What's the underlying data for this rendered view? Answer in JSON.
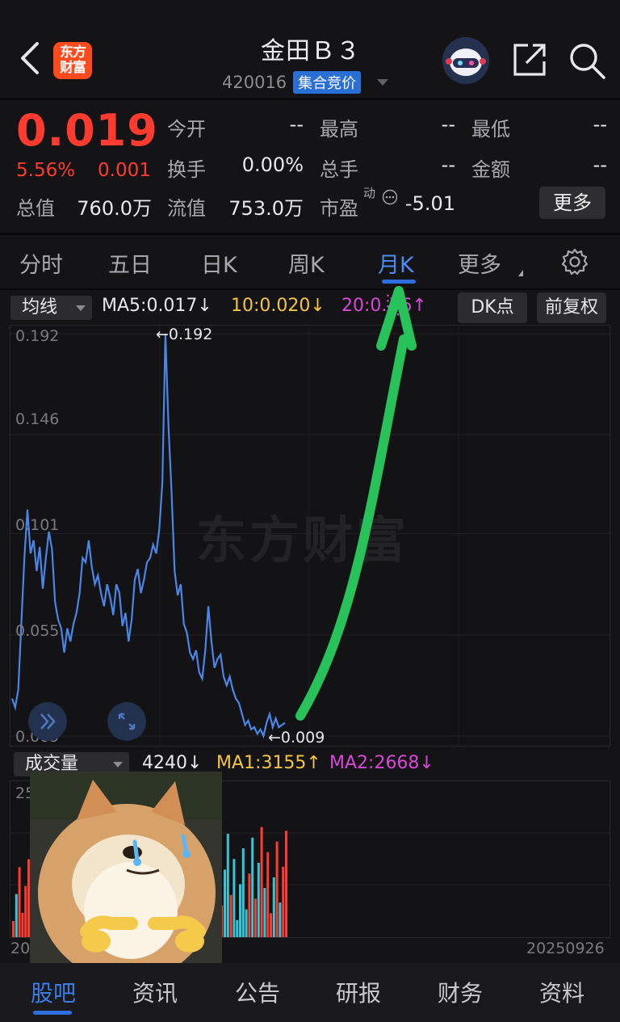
{
  "header": {
    "title": "金田Ｂ３",
    "code": "420016",
    "tag": "集合竞价",
    "logo_line1": "东方",
    "logo_line2": "财富"
  },
  "quote": {
    "price": "0.019",
    "change_pct": "5.56%",
    "change_val": "0.001",
    "labels": {
      "open": "今开",
      "high": "最高",
      "low": "最低",
      "turnover": "换手",
      "volume": "总手",
      "amount": "金额",
      "market_cap": "总值",
      "float_cap": "流值",
      "pe": "市盈",
      "pe_sup": "动"
    },
    "values": {
      "open": "--",
      "high": "--",
      "low": "--",
      "turnover": "0.00%",
      "volume": "--",
      "amount": "--",
      "market_cap": "760.0万",
      "float_cap": "753.0万",
      "pe": "-5.01"
    },
    "more": "更多"
  },
  "tabs": {
    "items": [
      "分时",
      "五日",
      "日K",
      "周K",
      "月K",
      "更多"
    ],
    "active": "月K"
  },
  "indicator": {
    "select": "均线",
    "ma5": "MA5:0.017↓",
    "ma10": "10:0.020↓",
    "ma20": "20:0.░6↑",
    "dk": "DK点",
    "fq": "前复权"
  },
  "volume": {
    "select": "成交量",
    "v": "4240↓",
    "ma1": "MA1:3155↑",
    "ma2": "MA2:2668↓",
    "y_top": "25",
    "date_left": "20",
    "date_right": "20250926"
  },
  "chart_data": {
    "type": "line",
    "y_ticks": [
      "0.192",
      "0.146",
      "0.101",
      "0.055",
      "0.009"
    ],
    "ylim": [
      0.009,
      0.192
    ],
    "max_label": "0.192",
    "min_label": "0.009",
    "watermark": "东方财富",
    "series": [
      {
        "color": "#4a86e8",
        "values": [
          0.026,
          0.022,
          0.03,
          0.06,
          0.09,
          0.112,
          0.092,
          0.098,
          0.084,
          0.095,
          0.076,
          0.09,
          0.102,
          0.094,
          0.07,
          0.062,
          0.058,
          0.047,
          0.058,
          0.052,
          0.06,
          0.065,
          0.074,
          0.09,
          0.088,
          0.098,
          0.086,
          0.078,
          0.082,
          0.074,
          0.068,
          0.078,
          0.072,
          0.064,
          0.078,
          0.074,
          0.059,
          0.065,
          0.052,
          0.062,
          0.08,
          0.085,
          0.074,
          0.08,
          0.088,
          0.09,
          0.096,
          0.092,
          0.103,
          0.124,
          0.192,
          0.15,
          0.12,
          0.084,
          0.073,
          0.078,
          0.06,
          0.056,
          0.047,
          0.044,
          0.048,
          0.038,
          0.035,
          0.048,
          0.068,
          0.052,
          0.04,
          0.044,
          0.046,
          0.036,
          0.032,
          0.036,
          0.03,
          0.026,
          0.024,
          0.019,
          0.014,
          0.016,
          0.012,
          0.013,
          0.01,
          0.012,
          0.009,
          0.015,
          0.019,
          0.013,
          0.017,
          0.013,
          0.014,
          0.015
        ]
      }
    ]
  },
  "bottom_nav": {
    "items": [
      "股吧",
      "资讯",
      "公告",
      "研报",
      "财务",
      "资料"
    ],
    "active": "股吧"
  }
}
